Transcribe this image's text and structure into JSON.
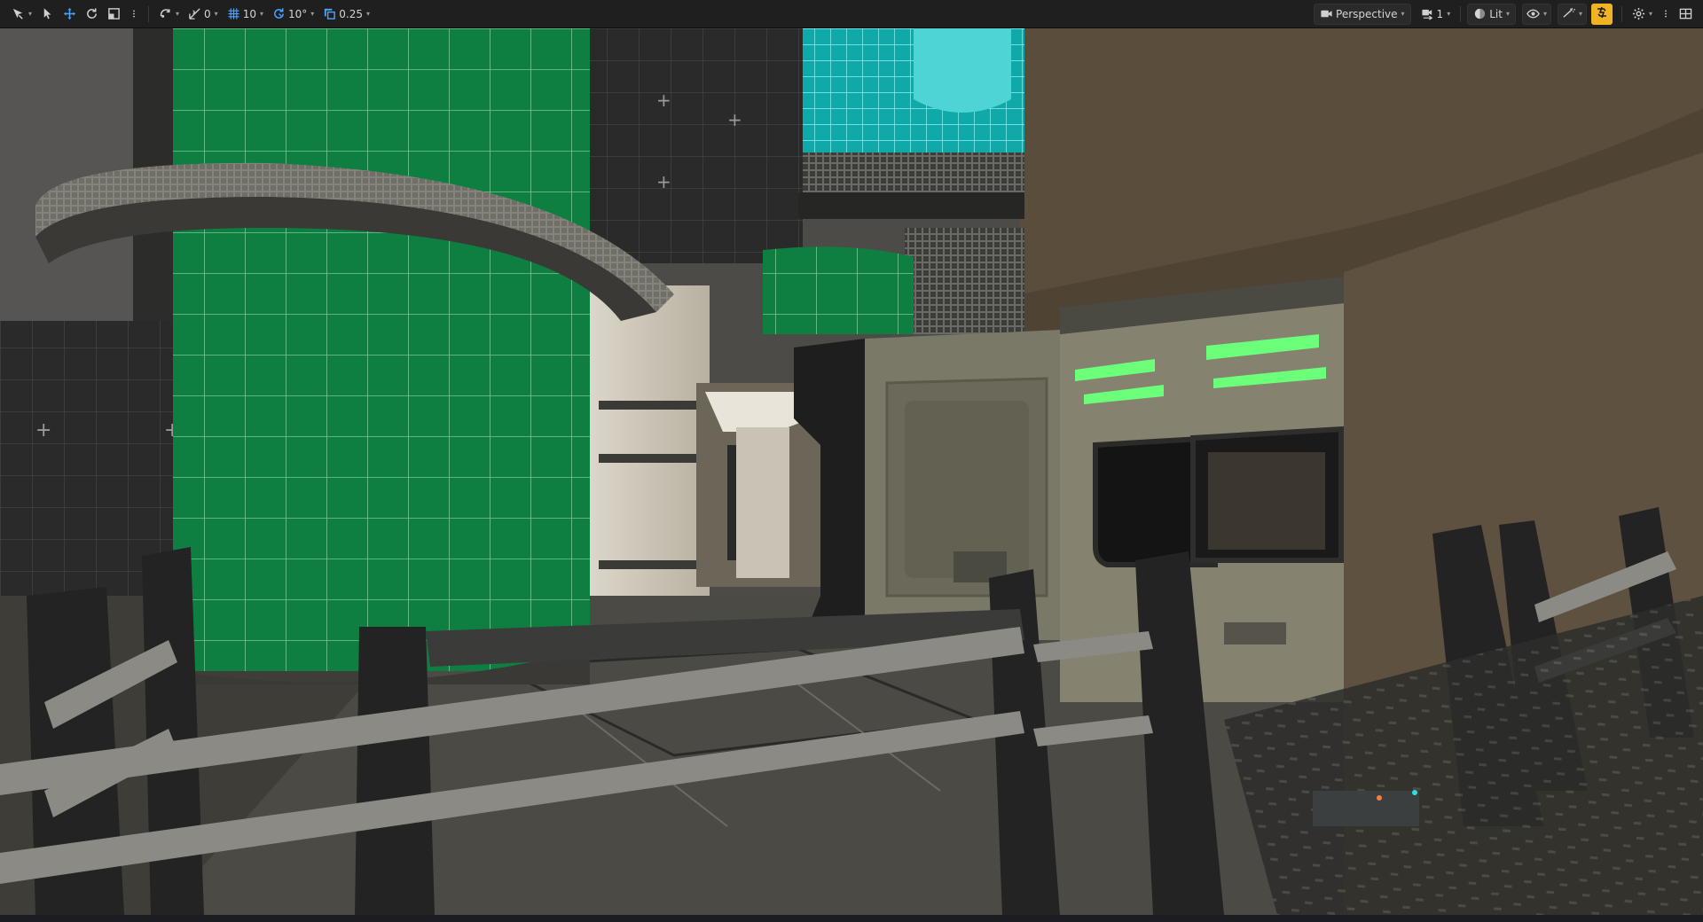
{
  "toolbar": {
    "transform_mode_label": "Select Mode",
    "surface_snap_value": "0",
    "grid_snap_value": "10",
    "rotation_snap_value": "10°",
    "scale_snap_value": "0.25",
    "perspective_label": "Perspective",
    "camera_speed_value": "1",
    "view_mode_label": "Lit"
  },
  "icons": {
    "select_mode": "select-mode-icon",
    "select": "pointer-icon",
    "translate": "move-icon",
    "rotate": "rotate-icon",
    "scale": "scale-icon",
    "more": "more-vertical-icon",
    "world_local": "world-icon",
    "surface_snap": "surface-snap-icon",
    "grid_snap": "grid-snap-icon",
    "rotation_snap": "rotation-snap-icon",
    "scale_snap": "scale-snap-icon",
    "camera": "camera-icon",
    "camera_speed": "camera-speed-icon",
    "lit": "lit-sphere-icon",
    "show": "eye-icon",
    "realtime": "realtime-icon",
    "game_view": "game-view-icon",
    "settings": "settings-gear-icon",
    "layout": "viewport-layout-icon"
  },
  "colors": {
    "accent": "#f0b323",
    "toolbar_bg": "#1f1f1f",
    "emissive_green": "#6cff7a",
    "green_tile": "#0f8a45",
    "cyan_tile": "#13c0c0"
  }
}
